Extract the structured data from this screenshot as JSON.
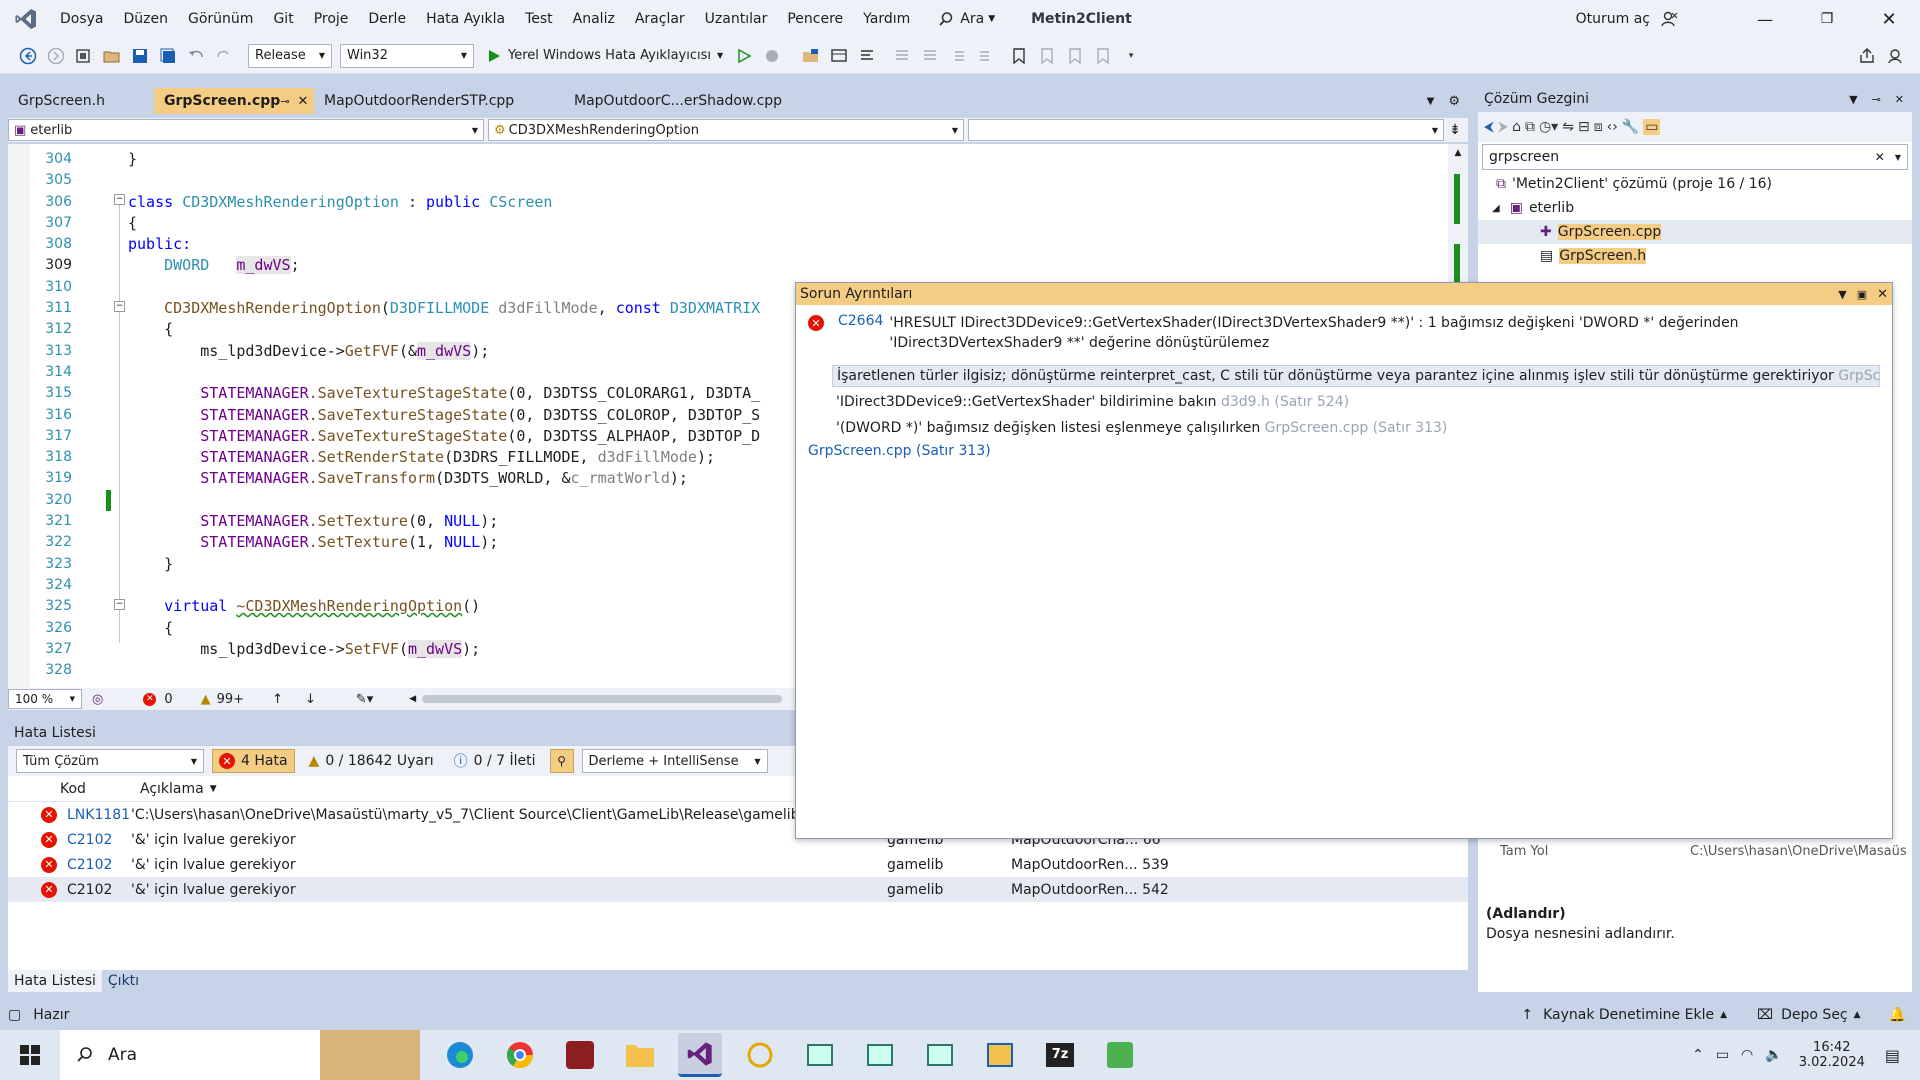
{
  "menu": {
    "items": [
      "Dosya",
      "Düzen",
      "Görünüm",
      "Git",
      "Proje",
      "Derle",
      "Hata Ayıkla",
      "Test",
      "Analiz",
      "Araçlar",
      "Uzantılar",
      "Pencere",
      "Yardım"
    ],
    "search_label": "Ara",
    "solution_title": "Metin2Client",
    "signin_label": "Oturum aç"
  },
  "toolbar": {
    "config": "Release",
    "platform": "Win32",
    "debugger_label": "Yerel Windows Hata Ayıklayıcısı"
  },
  "editor_tabs": [
    {
      "label": "GrpScreen.h",
      "active": false
    },
    {
      "label": "GrpScreen.cpp",
      "active": true
    },
    {
      "label": "MapOutdoorRenderSTP.cpp",
      "active": false
    },
    {
      "label": "MapOutdoorC...erShadow.cpp",
      "active": false
    }
  ],
  "nav": {
    "project": "eterlib",
    "scope": "CD3DXMeshRenderingOption",
    "member": ""
  },
  "code": {
    "line_numbers": [
      "304",
      "305",
      "306",
      "307",
      "308",
      "309",
      "310",
      "311",
      "312",
      "313",
      "314",
      "315",
      "316",
      "317",
      "318",
      "319",
      "320",
      "321",
      "322",
      "323",
      "324",
      "325",
      "326",
      "327",
      "328"
    ],
    "current_line": "309",
    "lines": {
      "l304": "}",
      "l306a": "class ",
      "l306b": "CD3DXMeshRenderingOption",
      "l306c": " : ",
      "l306d": "public ",
      "l306e": "CScreen",
      "l307": "{",
      "l308": "public:",
      "l309a": "DWORD",
      "l309b": "m_dwVS",
      "l311a": "CD3DXMeshRenderingOption",
      "l311b": "(",
      "l311c": "D3DFILLMODE",
      "l311d": " d3dFillMode",
      "l311e": ", ",
      "l311f": "const ",
      "l311g": "D3DXMATRIX",
      "l312": "{",
      "l313a": "ms_lpd3dDevice->",
      "l313b": "GetFVF",
      "l313c": "(&",
      "l313d": "m_dwVS",
      "l313e": ");",
      "l315a": "STATEMANAGER",
      "l315b": ".SaveTextureStageState",
      "l315c": "(0, D3DTSS_COLORARG1, D3DTA_",
      "l316c": "(0, D3DTSS_COLOROP, D3DTOP_S",
      "l317c": "(0, D3DTSS_ALPHAOP, D3DTOP_D",
      "l318b": ".SetRenderState",
      "l318c": "(D3DRS_FILLMODE, ",
      "l318d": "d3dFillMode",
      "l318e": ");",
      "l319b": ".SaveTransform",
      "l319c": "(D3DTS_WORLD, &",
      "l319d": "c_rmatWorld",
      "l319e": ");",
      "l321b": ".SetTexture",
      "l321c": "(0, ",
      "l321d": "NULL",
      "l321e": ");",
      "l322c": "(1, ",
      "l323": "}",
      "l325a": "virtual ",
      "l325b": "~CD3DXMeshRenderingOption",
      "l325c": "()",
      "l326": "{",
      "l327a": "ms_lpd3dDevice->",
      "l327b": "SetFVF",
      "l327c": "(",
      "l327d": "m_dwVS",
      "l327e": ");"
    }
  },
  "editor_status": {
    "zoom": "100 %",
    "errors": "0",
    "warnings": "99+"
  },
  "error_list": {
    "title": "Hata Listesi",
    "scope": "Tüm Çözüm",
    "errors_label": "4 Hata",
    "warnings_label": "0 / 18642 Uyarı",
    "messages_label": "0 / 7 İleti",
    "build_filter": "Derleme + IntelliSense",
    "col_code": "Kod",
    "col_desc": "Açıklama",
    "rows": [
      {
        "code": "LNK1181",
        "desc": "'C:\\Users\\hasan\\OneDrive\\Masaüstü\\marty_v5_7\\Client Source\\Client\\GameLib\\Release\\gamelib.lib",
        "project": "",
        "file": ""
      },
      {
        "code": "C2102",
        "desc": "'&' için lvalue gerekiyor",
        "project": "gamelib",
        "file": "MapOutdoorCha... 66"
      },
      {
        "code": "C2102",
        "desc": "'&' için lvalue gerekiyor",
        "project": "gamelib",
        "file": "MapOutdoorRen... 539"
      },
      {
        "code": "C2102",
        "desc": "'&' için lvalue gerekiyor",
        "project": "gamelib",
        "file": "MapOutdoorRen... 542"
      }
    ],
    "bottom_tabs": [
      "Hata Listesi",
      "Çıktı"
    ]
  },
  "solution_explorer": {
    "title": "Çözüm Gezgini",
    "search_value": "grpscreen",
    "solution_label": "'Metin2Client' çözümü (proje 16 / 16)",
    "project_label": "eterlib",
    "files": [
      "GrpScreen.cpp",
      "GrpScreen.h"
    ]
  },
  "properties": {
    "full_path_label": "Tam Yol",
    "full_path_value": "C:\\Users\\hasan\\OneDrive\\Masaüs",
    "desc_title": "(Adlandır)",
    "desc_text": "Dosya nesnesini adlandırır."
  },
  "popup": {
    "title": "Sorun Ayrıntıları",
    "code": "C2664",
    "message": "'HRESULT IDirect3DDevice9::GetVertexShader(IDirect3DVertexShader9 **)' : 1 bağımsız değişkeni 'DWORD *' değerinden 'IDirect3DVertexShader9 **' değerine dönüştürülemez",
    "details": [
      {
        "text": "İşaretlenen türler ilgisiz; dönüştürme reinterpret_cast, C stili tür dönüştürme veya parantez içine alınmış işlev stili tür dönüştürme gerektiriyor",
        "loc": "GrpScreen.cpp ("
      },
      {
        "text": "'IDirect3DDevice9::GetVertexShader' bildirimine bakın",
        "loc": "d3d9.h (Satır 524)"
      },
      {
        "text": "'(DWORD *)' bağımsız değişken listesi eşlenmeye çalışılırken",
        "loc": "GrpScreen.cpp (Satır 313)"
      }
    ],
    "link": "GrpScreen.cpp (Satır 313)"
  },
  "statusbar": {
    "ready": "Hazır",
    "source_control": "Kaynak Denetimine Ekle",
    "repo": "Depo Seç"
  },
  "taskbar": {
    "search": "Ara",
    "time": "16:42",
    "date": "3.02.2024"
  },
  "colors": {
    "accent": "#f5cc84",
    "error": "#e51400",
    "link": "#1a5fb4",
    "vs_purple": "#68217a"
  }
}
